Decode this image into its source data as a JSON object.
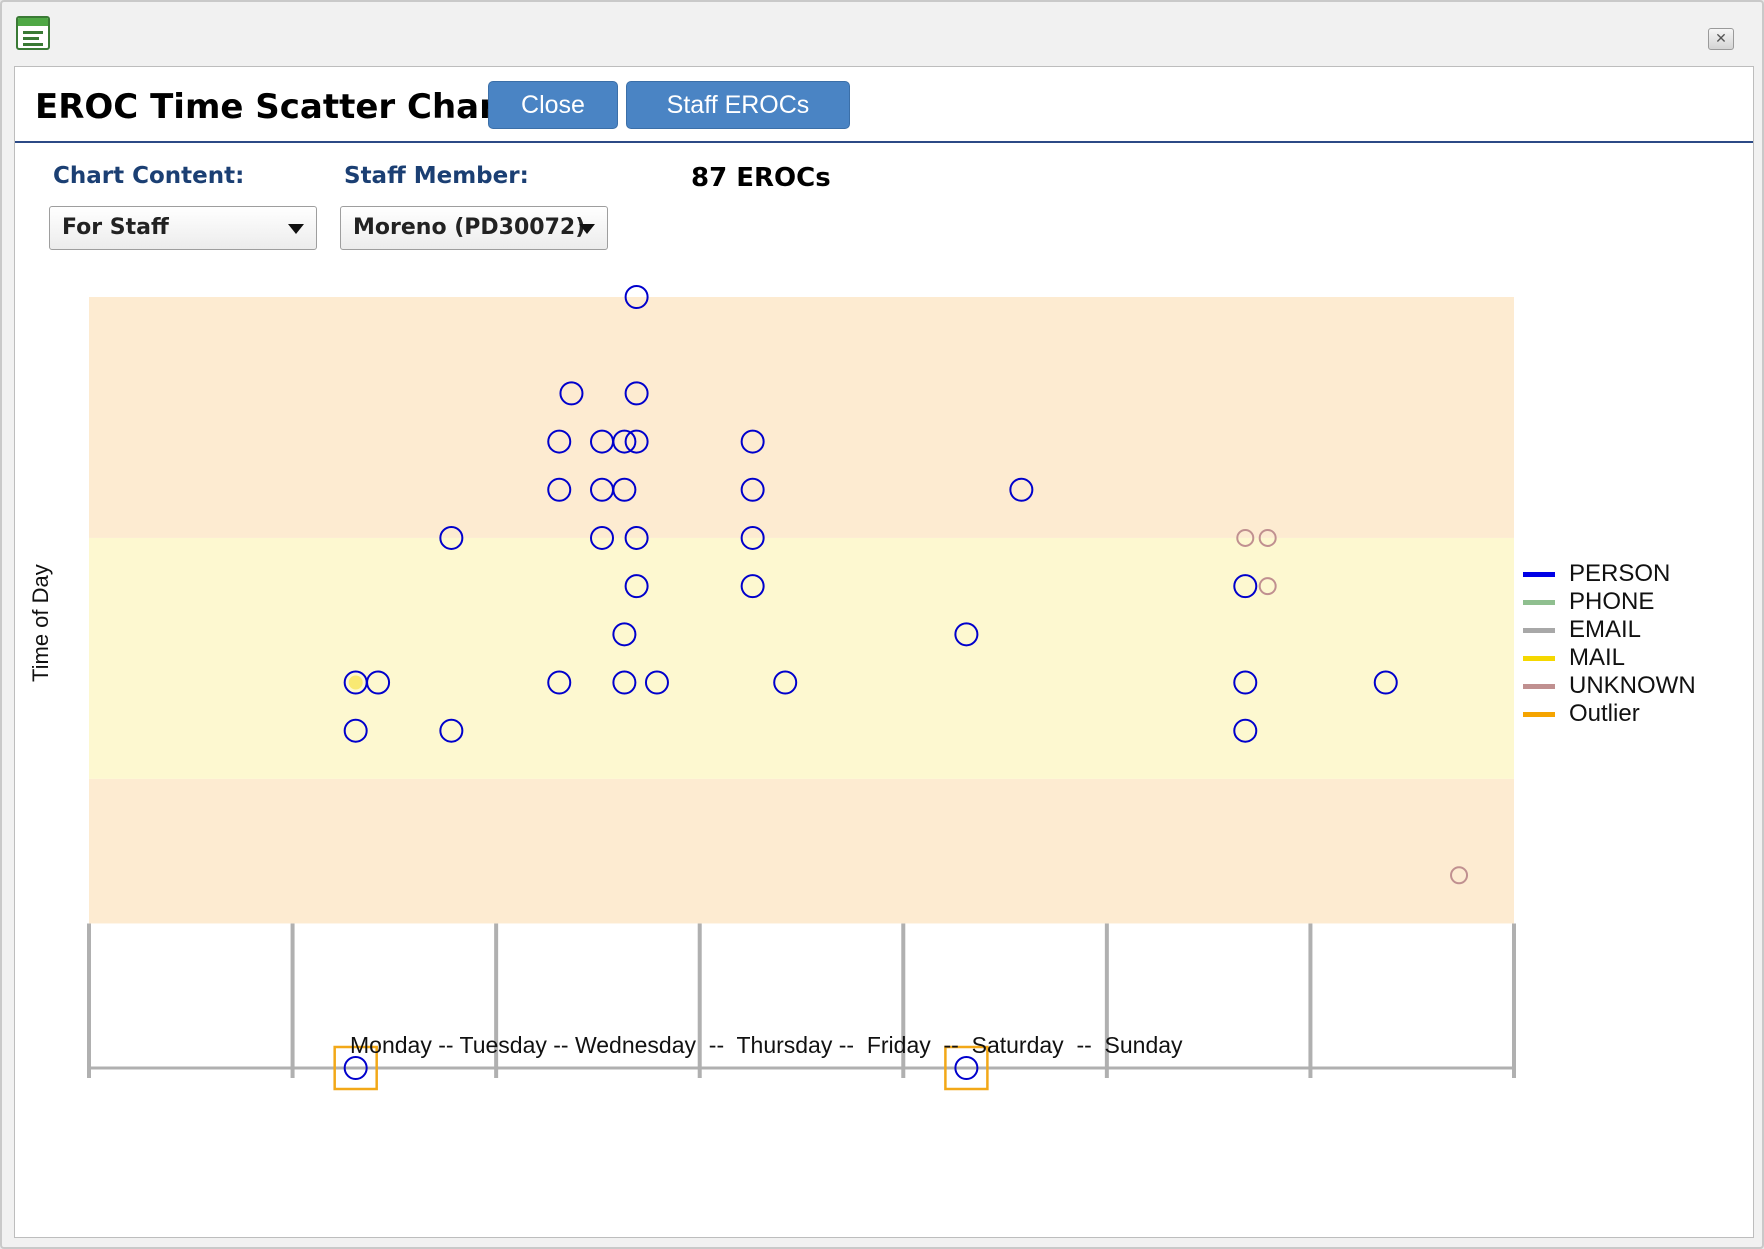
{
  "window": {
    "app_icon": "report-window-icon",
    "close_icon": "close-icon",
    "close_glyph": "✕"
  },
  "header": {
    "title": "EROC Time Scatter Chart",
    "close_label": "Close",
    "staff_erocs_label": "Staff EROCs"
  },
  "filters": {
    "chart_content_label": "Chart Content:",
    "chart_content_value": "For Staff",
    "staff_member_label": "Staff Member:",
    "staff_member_value": "Moreno (PD30072)",
    "count_text": "87 EROCs"
  },
  "colors": {
    "band_outer": "#fdebd1",
    "band_inner": "#fdf8d0",
    "grid": "#b0b0b0",
    "outlier_box": "#f2a818"
  },
  "chart_data": {
    "type": "scatter",
    "xlabel": "Monday -- Tuesday -- Wednesday  --  Thursday --  Friday  --  Saturday  --  Sunday",
    "ylabel": "Time of Day",
    "xlim": [
      0,
      7
    ],
    "ylim": [
      0,
      16
    ],
    "bands": [
      {
        "from": 3,
        "to": 6,
        "color": "#fdebd1"
      },
      {
        "from": 6,
        "to": 11,
        "color": "#fdf8d0"
      },
      {
        "from": 11,
        "to": 16,
        "color": "#fdebd1"
      }
    ],
    "legend": [
      {
        "name": "PERSON",
        "color": "#0000e6"
      },
      {
        "name": "PHONE",
        "color": "#8fbf8f"
      },
      {
        "name": "EMAIL",
        "color": "#a8a8a8"
      },
      {
        "name": "MAIL",
        "color": "#f5d800"
      },
      {
        "name": "UNKNOWN",
        "color": "#c09090"
      },
      {
        "name": "Outlier",
        "color": "#f5a400"
      }
    ],
    "series": [
      {
        "name": "PERSON",
        "color": "#0000cc",
        "points": [
          [
            1.31,
            8
          ],
          [
            1.42,
            8
          ],
          [
            1.31,
            7
          ],
          [
            1.78,
            11
          ],
          [
            1.78,
            7
          ],
          [
            2.31,
            13
          ],
          [
            2.31,
            12
          ],
          [
            2.31,
            8
          ],
          [
            2.37,
            14
          ],
          [
            2.52,
            13
          ],
          [
            2.52,
            12
          ],
          [
            2.52,
            11
          ],
          [
            2.63,
            13
          ],
          [
            2.63,
            12
          ],
          [
            2.63,
            9
          ],
          [
            2.63,
            8
          ],
          [
            2.69,
            16
          ],
          [
            2.69,
            14
          ],
          [
            2.69,
            13
          ],
          [
            2.69,
            11
          ],
          [
            2.69,
            10
          ],
          [
            2.79,
            8
          ],
          [
            3.26,
            13
          ],
          [
            3.26,
            12
          ],
          [
            3.26,
            11
          ],
          [
            3.26,
            10
          ],
          [
            3.42,
            8
          ],
          [
            4.31,
            9
          ],
          [
            4.58,
            12
          ],
          [
            5.68,
            10
          ],
          [
            5.68,
            8
          ],
          [
            5.68,
            7
          ],
          [
            6.37,
            8
          ]
        ]
      },
      {
        "name": "MAIL",
        "color": "#f5d800",
        "points": [
          [
            1.31,
            8
          ]
        ]
      },
      {
        "name": "UNKNOWN",
        "color": "#c09090",
        "points": [
          [
            5.68,
            11
          ],
          [
            5.79,
            11
          ],
          [
            5.79,
            10
          ],
          [
            6.73,
            4
          ]
        ]
      },
      {
        "name": "Outlier",
        "color": "#0000cc",
        "points": [
          [
            1.31,
            0
          ],
          [
            4.31,
            0
          ]
        ]
      }
    ]
  }
}
